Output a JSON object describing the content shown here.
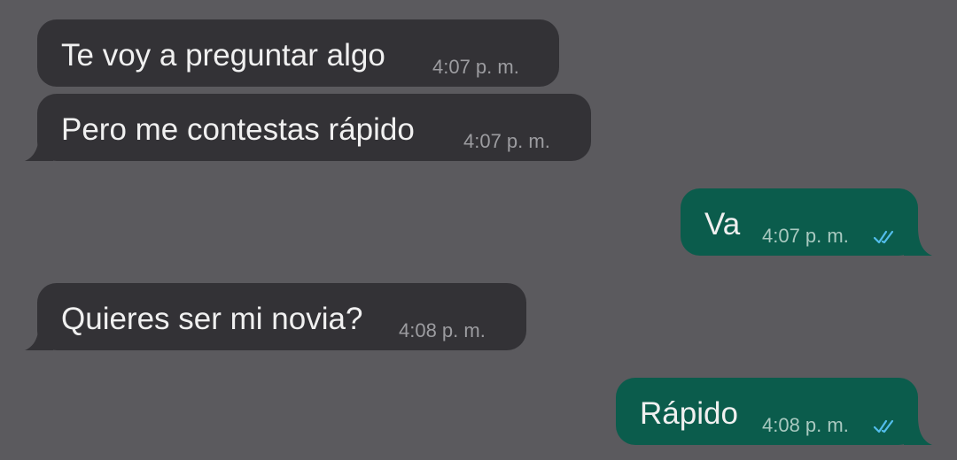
{
  "messages": [
    {
      "direction": "incoming",
      "text": "Te voy a preguntar algo",
      "time": "4:07 p. m."
    },
    {
      "direction": "incoming",
      "text": "Pero me contestas rápido",
      "time": "4:07 p. m."
    },
    {
      "direction": "outgoing",
      "text": "Va",
      "time": "4:07 p. m.",
      "status_icon": "double-check-icon"
    },
    {
      "direction": "incoming",
      "text": "Quieres ser mi novia?",
      "time": "4:08 p. m."
    },
    {
      "direction": "outgoing",
      "text": "Rápido",
      "time": "4:08 p. m.",
      "status_icon": "double-check-icon"
    }
  ],
  "colors": {
    "background": "#5b5a5e",
    "incoming_bubble": "#333236",
    "outgoing_bubble": "#0b5c4c",
    "read_check": "#53bdeb"
  }
}
